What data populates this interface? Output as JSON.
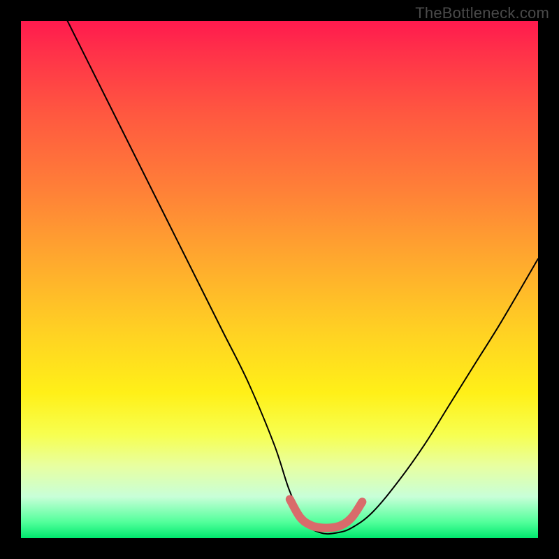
{
  "watermark": "TheBottleneck.com",
  "chart_data": {
    "type": "line",
    "title": "",
    "xlabel": "",
    "ylabel": "",
    "xlim": [
      0,
      100
    ],
    "ylim": [
      0,
      100
    ],
    "series": [
      {
        "name": "bottleneck-curve",
        "x": [
          9,
          14,
          19,
          24,
          29,
          34,
          39,
          44,
          49,
          52,
          55,
          58,
          61,
          64,
          68,
          73,
          78,
          83,
          88,
          93,
          100
        ],
        "y": [
          100,
          90,
          80,
          70,
          60,
          50,
          40,
          30,
          18,
          9,
          3,
          1,
          1,
          2,
          5,
          11,
          18,
          26,
          34,
          42,
          54
        ]
      },
      {
        "name": "optimal-range-marker",
        "x": [
          52,
          54,
          56,
          58,
          60,
          62,
          64,
          66
        ],
        "y": [
          7.5,
          4.0,
          2.5,
          2.0,
          2.0,
          2.5,
          4.0,
          7.0
        ]
      }
    ],
    "colors": {
      "curve": "#000000",
      "marker": "#d96b6b",
      "gradient_top": "#ff1a4e",
      "gradient_bottom": "#00e86e"
    }
  }
}
